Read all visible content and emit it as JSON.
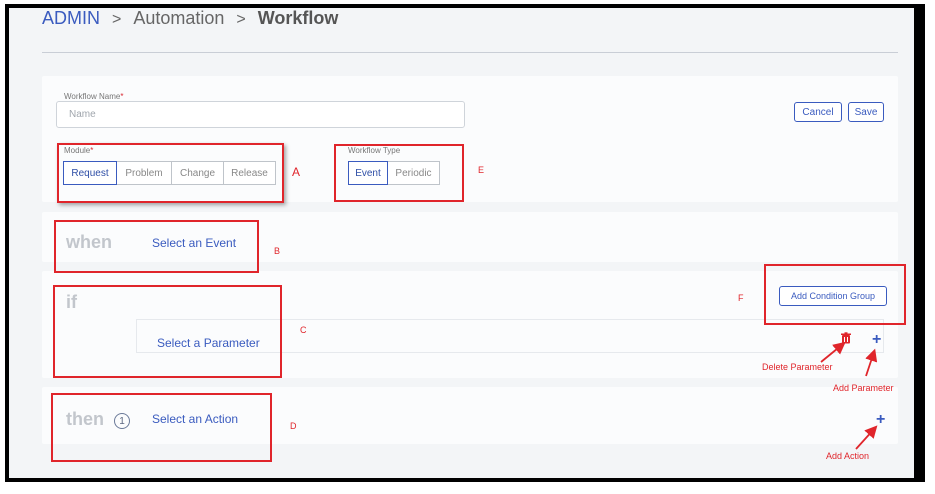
{
  "breadcrumb": {
    "admin": "ADMIN",
    "sep1": ">",
    "automation": "Automation",
    "sep2": ">",
    "workflow": "Workflow"
  },
  "form": {
    "name_label": "Workflow Name",
    "required_mark": "*",
    "name_placeholder": "Name",
    "name_value": "",
    "module_label": "Module",
    "modules": [
      "Request",
      "Problem",
      "Change",
      "Release"
    ],
    "module_selected": "Request",
    "type_label": "Workflow Type",
    "types": [
      "Event",
      "Periodic"
    ],
    "type_selected": "Event",
    "cancel_label": "Cancel",
    "save_label": "Save"
  },
  "when": {
    "word": "when",
    "placeholder": "Select an Event"
  },
  "if": {
    "word": "if",
    "add_condition_group": "Add Condition Group",
    "parameter_placeholder": "Select a Parameter"
  },
  "then": {
    "word": "then",
    "step_number": "1",
    "placeholder": "Select an Action"
  },
  "annotations": {
    "A": "A",
    "B": "B",
    "C": "C",
    "D": "D",
    "E": "E",
    "F": "F",
    "delete_parameter": "Delete Parameter",
    "add_parameter": "Add Parameter",
    "add_action": "Add Action"
  },
  "icons": {
    "plus": "+",
    "trash": "trash-icon"
  },
  "colors": {
    "accent": "#3a5bbf",
    "annotation_red": "#e0252b",
    "section_word": "#c2c6cc",
    "background": "#f3f5f7"
  }
}
